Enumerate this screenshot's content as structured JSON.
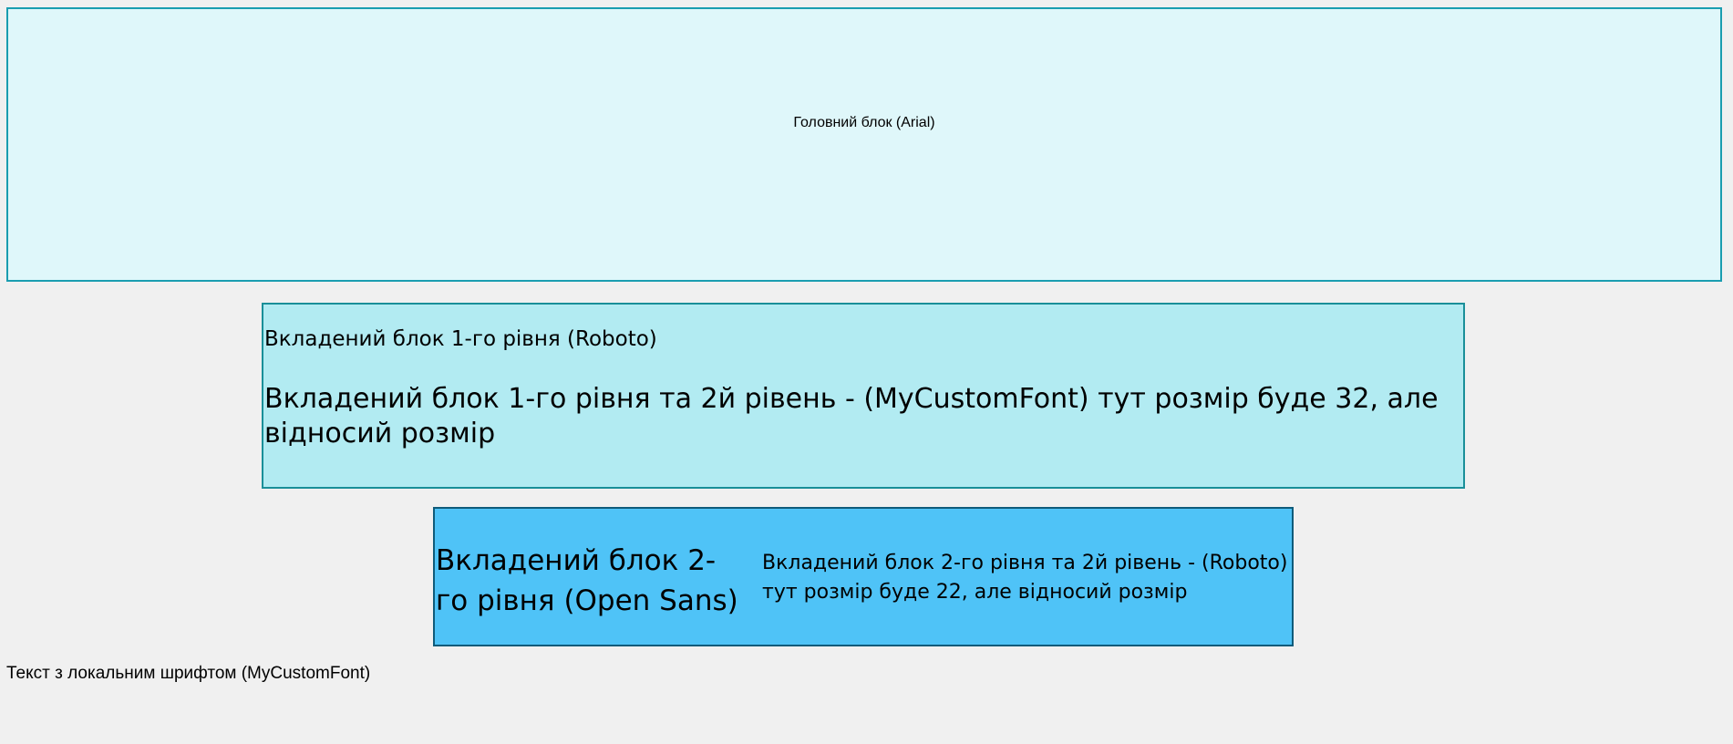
{
  "main_block": {
    "text": "Головний блок (Arial)"
  },
  "level1_block": {
    "text": "Вкладений блок 1-го рівня (Roboto)",
    "sub_text": "Вкладений блок 1-го рівня та 2й рівень - (MyCustomFont) тут розмір буде 32, але відносий розмір"
  },
  "level2_block": {
    "text": "Вкладений блок 2-го рівня (Open Sans)",
    "sub_text": "Вкладений блок 2-го рівня та 2й рівень - (Roboto) тут розмір буде 22, але відносий розмір"
  },
  "local_font_text": "Текст з локальним шрифтом (MyCustomFont)",
  "colors": {
    "page_background": "#f0f0f0",
    "main_block_background": "#dff7fa",
    "main_block_border": "#1a9db0",
    "level1_background": "#b2ebf2",
    "level1_border": "#1a8f99",
    "level2_background": "#4fc3f7",
    "level2_border": "#0f5b7a"
  }
}
